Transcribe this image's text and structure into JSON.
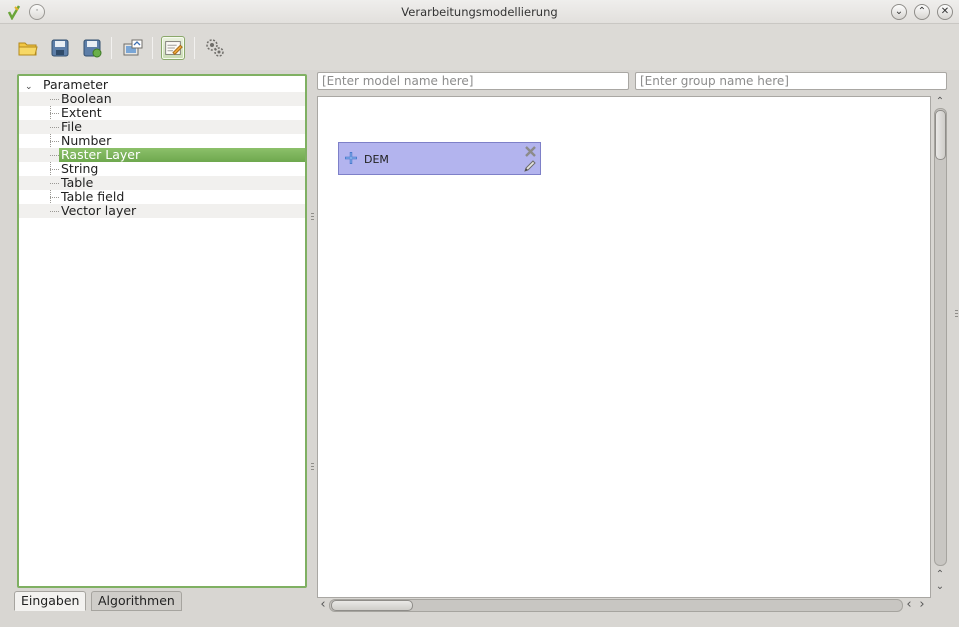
{
  "window": {
    "title": "Verarbeitungsmodellierung",
    "menu_glyph": "·",
    "minimize_glyph": "⌄",
    "maximize_glyph": "⌃",
    "close_glyph": "✕"
  },
  "toolbar": {
    "buttons": [
      {
        "name": "open-model-button",
        "icon": "folder-open-icon"
      },
      {
        "name": "save-button",
        "icon": "save-icon"
      },
      {
        "name": "save-as-button",
        "icon": "save-as-icon"
      },
      {
        "name": "export-image-button",
        "icon": "export-image-icon"
      },
      {
        "name": "edit-help-button",
        "icon": "edit-help-icon",
        "active": true
      },
      {
        "name": "run-model-button",
        "icon": "run-gears-icon"
      }
    ]
  },
  "inputs_tree": {
    "root_label": "Parameter",
    "expander_glyph": "⌄",
    "items": [
      {
        "label": "Boolean"
      },
      {
        "label": "Extent"
      },
      {
        "label": "File"
      },
      {
        "label": "Number"
      },
      {
        "label": "Raster Layer",
        "selected": true
      },
      {
        "label": "String"
      },
      {
        "label": "Table"
      },
      {
        "label": "Table field"
      },
      {
        "label": "Vector layer"
      }
    ]
  },
  "tabs": [
    {
      "label": "Eingaben",
      "active": true
    },
    {
      "label": "Algorithmen",
      "active": false
    }
  ],
  "model_name": {
    "value": "",
    "placeholder": "[Enter model name here]"
  },
  "group_name": {
    "value": "",
    "placeholder": "[Enter group name here]"
  },
  "canvas": {
    "nodes": [
      {
        "label": "DEM",
        "color": "#b3b4ee"
      }
    ]
  },
  "scroll": {
    "up_glyph": "⌃",
    "down_glyph": "⌄",
    "left_glyph": "‹",
    "right_glyph": "›"
  },
  "colors": {
    "selection": "#7ab35a",
    "panel_border": "#7fb062",
    "node_fill": "#b3b4ee"
  }
}
